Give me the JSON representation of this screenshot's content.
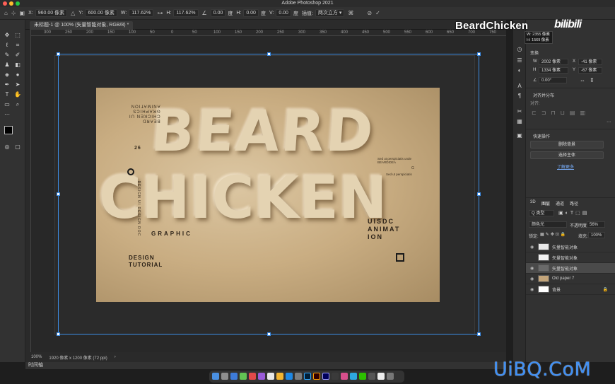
{
  "app": {
    "title": "Adobe Photoshop 2021"
  },
  "options_bar": {
    "x_label": "X:",
    "x_value": "960.00 像素",
    "y_label": "Y:",
    "y_value": "600.00 像素",
    "w_label": "W:",
    "w_value": "117.62%",
    "h_label": "H:",
    "h_value": "117.62%",
    "rot_value": "0.00",
    "deg": "度",
    "hs_label": "H:",
    "hs_value": "0.00",
    "vs_label": "V:",
    "vs_value": "0.00",
    "interp_label": "插值:",
    "interp_value": "两次立方 ▾"
  },
  "document_tab": {
    "label": "未标题-1 @ 100% (矢量智能对象, RGB/8) *"
  },
  "ruler_ticks": [
    "300",
    "250",
    "200",
    "150",
    "100",
    "50",
    "0",
    "50",
    "100",
    "150",
    "200",
    "250",
    "300",
    "350",
    "400",
    "450",
    "500",
    "550",
    "600",
    "650",
    "700",
    "750",
    "800"
  ],
  "artwork": {
    "line1": "BEARD",
    "line2": "CHICKEN",
    "mirror_text": "BEARD\nCHICKEN UI\nGRAPHICS\nANIMATION",
    "number": "26",
    "vertical_text": "DESIGN UI DESIGN DOC",
    "graphic": "GRAPHIC",
    "design_tutorial": "DESIGN\nTUTORIAL",
    "uisdc": "UISDC\nANIMAT\nION",
    "note1": "Sed ut perspiciatis unde\nBEARDIDEA",
    "note_g": "G",
    "note2": "Sed ut perspiciatis"
  },
  "status": {
    "zoom": "100%",
    "doc_info": "1920 像素 x 1200 像素 (72 ppi)",
    "arrow": "›"
  },
  "timeline": {
    "label": "时间轴"
  },
  "tooltip": {
    "w": "W: 2355 像素",
    "h": "H: 1569 像素"
  },
  "properties": {
    "section_transform": "变换",
    "w_label": "W",
    "w_value": "2002 像素",
    "x_label": "X",
    "x_value": "-41 像素",
    "h_label": "H",
    "h_value": "1334 像素",
    "y_label": "Y",
    "y_value": "-67 像素",
    "angle_value": "0.00°",
    "section_align": "对齐并分布",
    "align_label": "对齐:",
    "section_quick": "快速操作",
    "remove_bg": "删除背景",
    "select_subject": "选择主体",
    "learn_more": "了解更多"
  },
  "layers_panel": {
    "tabs": [
      "3D",
      "图层",
      "通道",
      "路径"
    ],
    "filter_label": "Q 类型",
    "blend_mode": "颜色光",
    "opacity_label": "不透明度:",
    "opacity_value": "56%",
    "lock_label": "锁定:",
    "fill_label": "填充:",
    "fill_value": "100%",
    "layers": [
      {
        "name": "矢量智能对象",
        "thumb": "#e8e8e8",
        "eye": true
      },
      {
        "name": "矢量智能对象",
        "thumb": "#f2f2f2",
        "eye": false
      },
      {
        "name": "矢量智能对象",
        "thumb": "#6a6a6a",
        "eye": true,
        "selected": true
      },
      {
        "name": "Old paper 7",
        "thumb": "#c2a47a",
        "eye": true
      },
      {
        "name": "背景",
        "thumb": "#ffffff",
        "eye": true,
        "lock": true
      }
    ]
  },
  "overlays": {
    "brand": "BeardChicken",
    "bilibili": "bilibili",
    "watermark": "UiBQ.CoM"
  },
  "colors": {
    "accent": "#3d8ee8",
    "panel": "#323232",
    "canvas": "#282828"
  }
}
